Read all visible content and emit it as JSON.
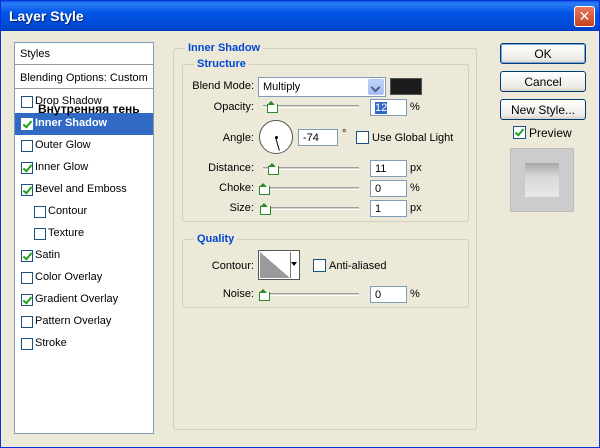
{
  "window": {
    "title": "Layer Style"
  },
  "left_list": {
    "styles_header": "Styles",
    "blending_header": "Blending Options: Custom",
    "items": [
      {
        "label": "Drop Shadow",
        "checked": false,
        "sub": false,
        "selected": false
      },
      {
        "label": "Inner Shadow",
        "checked": true,
        "sub": false,
        "selected": true
      },
      {
        "label": "Outer Glow",
        "checked": false,
        "sub": false,
        "selected": false
      },
      {
        "label": "Inner Glow",
        "checked": true,
        "sub": false,
        "selected": false
      },
      {
        "label": "Bevel and Emboss",
        "checked": true,
        "sub": false,
        "selected": false
      },
      {
        "label": "Contour",
        "checked": false,
        "sub": true,
        "selected": false
      },
      {
        "label": "Texture",
        "checked": false,
        "sub": true,
        "selected": false
      },
      {
        "label": "Satin",
        "checked": true,
        "sub": false,
        "selected": false
      },
      {
        "label": "Color Overlay",
        "checked": false,
        "sub": false,
        "selected": false
      },
      {
        "label": "Gradient Overlay",
        "checked": true,
        "sub": false,
        "selected": false
      },
      {
        "label": "Pattern Overlay",
        "checked": false,
        "sub": false,
        "selected": false
      },
      {
        "label": "Stroke",
        "checked": false,
        "sub": false,
        "selected": false
      }
    ],
    "overlay_text": "Внутренняя тень"
  },
  "panel": {
    "title": "Inner Shadow",
    "structure": {
      "legend": "Structure",
      "blend_mode_label": "Blend Mode:",
      "blend_mode_value": "Multiply",
      "shadow_color": "#1c1c1c",
      "opacity_label": "Opacity:",
      "opacity_value": "12",
      "opacity_unit": "%",
      "angle_label": "Angle:",
      "angle_value": "-74",
      "angle_unit": "°",
      "global_light_label": "Use Global Light",
      "global_light_checked": false,
      "distance_label": "Distance:",
      "distance_value": "11",
      "distance_unit": "px",
      "choke_label": "Choke:",
      "choke_value": "0",
      "choke_unit": "%",
      "size_label": "Size:",
      "size_value": "1",
      "size_unit": "px"
    },
    "quality": {
      "legend": "Quality",
      "contour_label": "Contour:",
      "anti_aliased_label": "Anti-aliased",
      "anti_aliased_checked": false,
      "noise_label": "Noise:",
      "noise_value": "0",
      "noise_unit": "%"
    }
  },
  "buttons": {
    "ok": "OK",
    "cancel": "Cancel",
    "new_style": "New Style...",
    "preview_label": "Preview",
    "preview_checked": true
  }
}
